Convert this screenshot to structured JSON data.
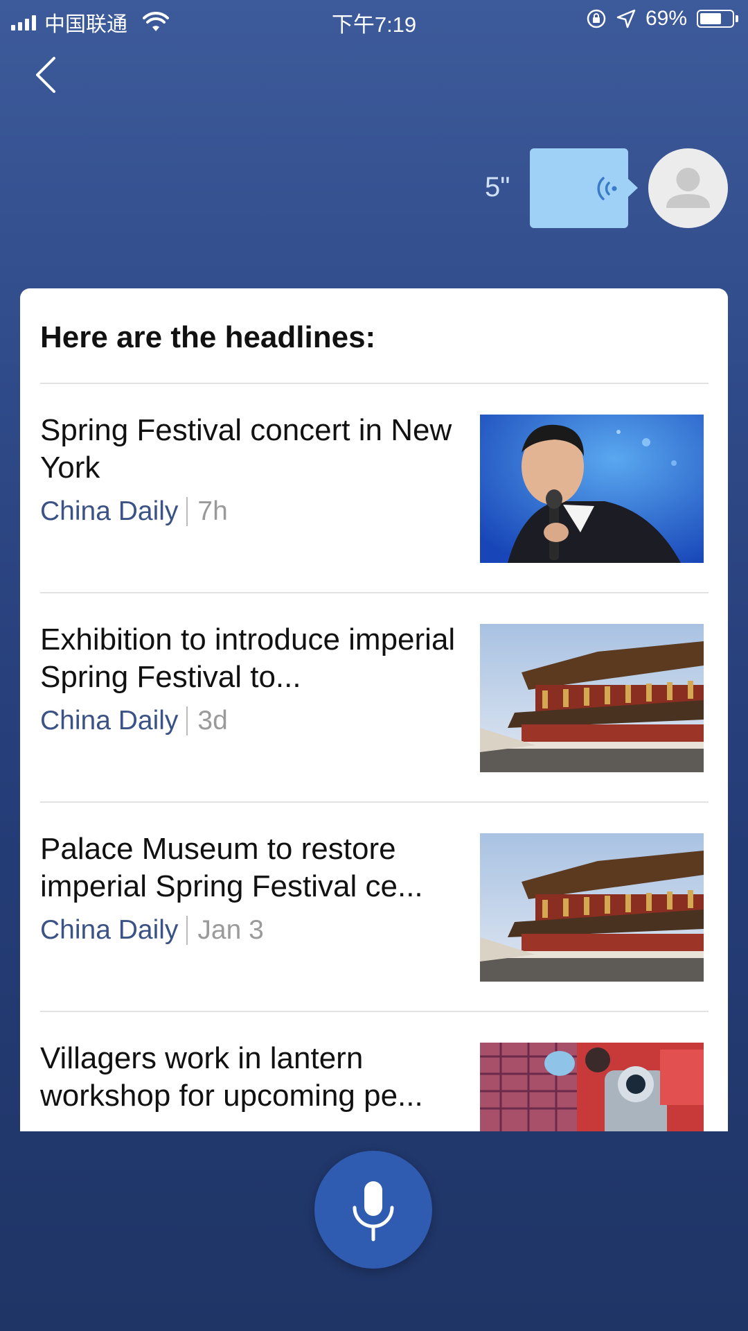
{
  "status_bar": {
    "carrier": "中国联通",
    "time": "下午7:19",
    "battery": "69%",
    "battery_level": 0.69
  },
  "voice_message": {
    "duration": "5\""
  },
  "card": {
    "title": "Here are the headlines:"
  },
  "news": [
    {
      "headline": "Spring Festival concert in New York",
      "source": "China Daily",
      "time": "7h",
      "thumbnail": "man-with-microphone"
    },
    {
      "headline": "Exhibition to introduce imperial Spring Festival to...",
      "source": "China Daily",
      "time": "3d",
      "thumbnail": "palace-building"
    },
    {
      "headline": "Palace Museum to restore imperial Spring Festival ce...",
      "source": "China Daily",
      "time": "Jan 3",
      "thumbnail": "palace-building"
    },
    {
      "headline": "Villagers work in lantern workshop for upcoming pe...",
      "source": "",
      "time": "",
      "thumbnail": "lantern-workshop"
    }
  ],
  "icons": {
    "back": "chevron-left-icon",
    "voice": "sound-wave-icon",
    "avatar": "user-avatar-icon",
    "mic": "microphone-icon"
  },
  "colors": {
    "background": "#2f4a88",
    "voice_bubble": "#9fd0f6",
    "source_text": "#3a5286",
    "mic_button": "#2f5cb0"
  }
}
